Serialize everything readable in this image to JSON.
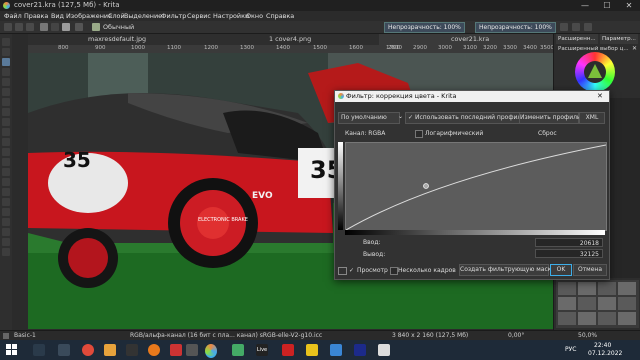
{
  "window": {
    "title": "cover21.kra (127,5 Мб) - Krita",
    "minimize": "—",
    "maximize": "☐",
    "close": "✕"
  },
  "menu": [
    "Файл",
    "Правка",
    "Вид",
    "Изображение",
    "Слой",
    "Выделение",
    "Фильтр",
    "Сервис",
    "Настройки",
    "Окно",
    "Справка"
  ],
  "toolbar": {
    "brush_name": "Обычный",
    "opacity_label": "Непрозрачность: 100%",
    "flow_label": "Непрозрачность: 100%"
  },
  "tabs": [
    "maxresdefault.jpg",
    "1 cover4.png",
    "cover21.kra"
  ],
  "ruler": [
    "800",
    "900",
    "1000",
    "1100",
    "1200",
    "1300",
    "1400",
    "1500",
    "1600",
    "1700",
    "2800",
    "2900",
    "3000",
    "3100",
    "3200",
    "3300",
    "3400",
    "3500"
  ],
  "docker": {
    "tab1": "Расширенн...",
    "tab2": "Параметр...",
    "header": "Расширенный выбор ц...",
    "close": "✕"
  },
  "car": {
    "number1": "35",
    "number2": "35",
    "brand": "EVO",
    "wheel_text": "ELECTRONIC BRAKE"
  },
  "dialog": {
    "title": "Фильтр: коррекция цвета - Krita",
    "close": "✕",
    "preset": "По умолчанию",
    "use_last": "Использовать последний профиль",
    "edit_profiles": "Изменить профили",
    "xml": "XML",
    "channel": "Канал: RGBA",
    "logarithmic": "Логарифмический",
    "reset": "Сброс",
    "input_label": "Ввод:",
    "input_value": "20618",
    "output_label": "Вывод:",
    "output_value": "32125",
    "preview": "Просмотр",
    "multiple_frames": "Несколько кадров",
    "create_mask": "Создать фильтрующую маску",
    "ok": "OK",
    "cancel": "Отмена"
  },
  "status": {
    "layer": "Basic-1",
    "colorspace": "RGB/альфа-канал (16 бит с пла... канал)  sRGB-elle-V2-g10.icc",
    "size": "3 840 x 2 160 (127,5 Мб)",
    "angle": "0,00°",
    "zoom": "50,0%"
  },
  "taskbar": {
    "lang": "РУС",
    "time": "22:40",
    "date": "07.12.2022"
  },
  "colors": {
    "accent": "#3daee9",
    "car_red": "#c8161e",
    "dialog_bg": "#323232"
  }
}
